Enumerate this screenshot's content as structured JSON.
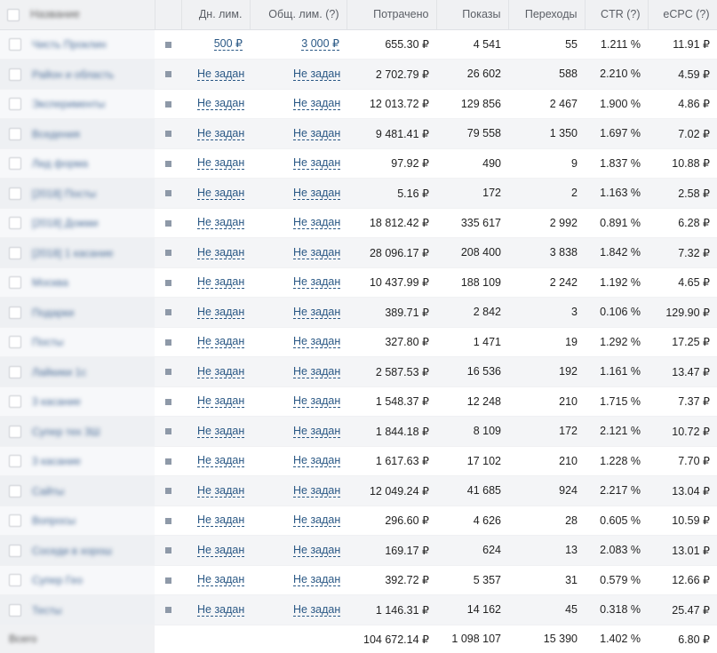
{
  "columns": {
    "name": "Название",
    "daily_limit": "Дн. лим.",
    "total_limit": "Общ. лим. (?)",
    "spent": "Потрачено",
    "impressions": "Показы",
    "clicks": "Переходы",
    "ctr": "CTR (?)",
    "ecpc": "eCPC (?)"
  },
  "rows": [
    {
      "name": "Чисть Проклин",
      "daily": "500 ₽",
      "total": "3 000 ₽",
      "spent": "655.30 ₽",
      "shows": "4 541",
      "clicks": "55",
      "ctr": "1.211 %",
      "ecpc": "11.91 ₽"
    },
    {
      "name": "Район и область",
      "daily": "Не задан",
      "total": "Не задан",
      "spent": "2 702.79 ₽",
      "shows": "26 602",
      "clicks": "588",
      "ctr": "2.210 %",
      "ecpc": "4.59 ₽"
    },
    {
      "name": "Эксперименты",
      "daily": "Не задан",
      "total": "Не задан",
      "spent": "12 013.72 ₽",
      "shows": "129 856",
      "clicks": "2 467",
      "ctr": "1.900 %",
      "ecpc": "4.86 ₽"
    },
    {
      "name": "Вседения",
      "daily": "Не задан",
      "total": "Не задан",
      "spent": "9 481.41 ₽",
      "shows": "79 558",
      "clicks": "1 350",
      "ctr": "1.697 %",
      "ecpc": "7.02 ₽"
    },
    {
      "name": "Лид форма",
      "daily": "Не задан",
      "total": "Не задан",
      "spent": "97.92 ₽",
      "shows": "490",
      "clicks": "9",
      "ctr": "1.837 %",
      "ecpc": "10.88 ₽"
    },
    {
      "name": "[2018] Посты",
      "daily": "Не задан",
      "total": "Не задан",
      "spent": "5.16 ₽",
      "shows": "172",
      "clicks": "2",
      "ctr": "1.163 %",
      "ecpc": "2.58 ₽"
    },
    {
      "name": "[2018] Дожми",
      "daily": "Не задан",
      "total": "Не задан",
      "spent": "18 812.42 ₽",
      "shows": "335 617",
      "clicks": "2 992",
      "ctr": "0.891 %",
      "ecpc": "6.28 ₽"
    },
    {
      "name": "[2018] 1 касание",
      "daily": "Не задан",
      "total": "Не задан",
      "spent": "28 096.17 ₽",
      "shows": "208 400",
      "clicks": "3 838",
      "ctr": "1.842 %",
      "ecpc": "7.32 ₽"
    },
    {
      "name": "Москва",
      "daily": "Не задан",
      "total": "Не задан",
      "spent": "10 437.99 ₽",
      "shows": "188 109",
      "clicks": "2 242",
      "ctr": "1.192 %",
      "ecpc": "4.65 ₽"
    },
    {
      "name": "Подарки",
      "daily": "Не задан",
      "total": "Не задан",
      "spent": "389.71 ₽",
      "shows": "2 842",
      "clicks": "3",
      "ctr": "0.106 %",
      "ecpc": "129.90 ₽"
    },
    {
      "name": "Посты",
      "daily": "Не задан",
      "total": "Не задан",
      "spent": "327.80 ₽",
      "shows": "1 471",
      "clicks": "19",
      "ctr": "1.292 %",
      "ecpc": "17.25 ₽"
    },
    {
      "name": "Лайкики 1с",
      "daily": "Не задан",
      "total": "Не задан",
      "spent": "2 587.53 ₽",
      "shows": "16 536",
      "clicks": "192",
      "ctr": "1.161 %",
      "ecpc": "13.47 ₽"
    },
    {
      "name": "3 касание",
      "daily": "Не задан",
      "total": "Не задан",
      "spent": "1 548.37 ₽",
      "shows": "12 248",
      "clicks": "210",
      "ctr": "1.715 %",
      "ecpc": "7.37 ₽"
    },
    {
      "name": "Супер тех 3Ш",
      "daily": "Не задан",
      "total": "Не задан",
      "spent": "1 844.18 ₽",
      "shows": "8 109",
      "clicks": "172",
      "ctr": "2.121 %",
      "ecpc": "10.72 ₽"
    },
    {
      "name": "3 касание",
      "daily": "Не задан",
      "total": "Не задан",
      "spent": "1 617.63 ₽",
      "shows": "17 102",
      "clicks": "210",
      "ctr": "1.228 %",
      "ecpc": "7.70 ₽"
    },
    {
      "name": "Сайты",
      "daily": "Не задан",
      "total": "Не задан",
      "spent": "12 049.24 ₽",
      "shows": "41 685",
      "clicks": "924",
      "ctr": "2.217 %",
      "ecpc": "13.04 ₽"
    },
    {
      "name": "Вопросы",
      "daily": "Не задан",
      "total": "Не задан",
      "spent": "296.60 ₽",
      "shows": "4 626",
      "clicks": "28",
      "ctr": "0.605 %",
      "ecpc": "10.59 ₽"
    },
    {
      "name": "Соседи в хорош",
      "daily": "Не задан",
      "total": "Не задан",
      "spent": "169.17 ₽",
      "shows": "624",
      "clicks": "13",
      "ctr": "2.083 %",
      "ecpc": "13.01 ₽"
    },
    {
      "name": "Супер Гео",
      "daily": "Не задан",
      "total": "Не задан",
      "spent": "392.72 ₽",
      "shows": "5 357",
      "clicks": "31",
      "ctr": "0.579 %",
      "ecpc": "12.66 ₽"
    },
    {
      "name": "Тесты",
      "daily": "Не задан",
      "total": "Не задан",
      "spent": "1 146.31 ₽",
      "shows": "14 162",
      "clicks": "45",
      "ctr": "0.318 %",
      "ecpc": "25.47 ₽"
    }
  ],
  "totals": {
    "label": "Всего",
    "spent": "104 672.14 ₽",
    "shows": "1 098 107",
    "clicks": "15 390",
    "ctr": "1.402 %",
    "ecpc": "6.80 ₽"
  },
  "colors": {
    "link": "#2a5885",
    "header_bg": "#f0f1f3",
    "row_alt_bg": "#f4f5f7",
    "row_icon": "#8e99a8"
  }
}
